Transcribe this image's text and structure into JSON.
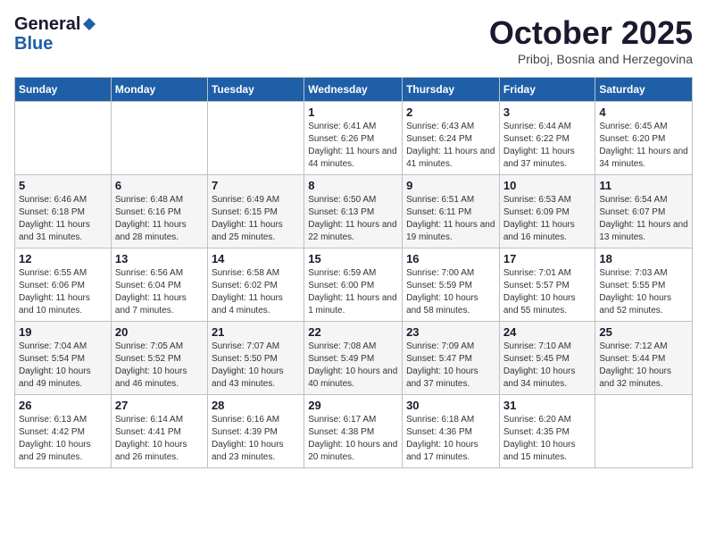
{
  "logo": {
    "general": "General",
    "blue": "Blue"
  },
  "title": "October 2025",
  "location": "Priboj, Bosnia and Herzegovina",
  "weekdays": [
    "Sunday",
    "Monday",
    "Tuesday",
    "Wednesday",
    "Thursday",
    "Friday",
    "Saturday"
  ],
  "weeks": [
    [
      {
        "day": "",
        "info": ""
      },
      {
        "day": "",
        "info": ""
      },
      {
        "day": "",
        "info": ""
      },
      {
        "day": "1",
        "info": "Sunrise: 6:41 AM\nSunset: 6:26 PM\nDaylight: 11 hours\nand 44 minutes."
      },
      {
        "day": "2",
        "info": "Sunrise: 6:43 AM\nSunset: 6:24 PM\nDaylight: 11 hours\nand 41 minutes."
      },
      {
        "day": "3",
        "info": "Sunrise: 6:44 AM\nSunset: 6:22 PM\nDaylight: 11 hours\nand 37 minutes."
      },
      {
        "day": "4",
        "info": "Sunrise: 6:45 AM\nSunset: 6:20 PM\nDaylight: 11 hours\nand 34 minutes."
      }
    ],
    [
      {
        "day": "5",
        "info": "Sunrise: 6:46 AM\nSunset: 6:18 PM\nDaylight: 11 hours\nand 31 minutes."
      },
      {
        "day": "6",
        "info": "Sunrise: 6:48 AM\nSunset: 6:16 PM\nDaylight: 11 hours\nand 28 minutes."
      },
      {
        "day": "7",
        "info": "Sunrise: 6:49 AM\nSunset: 6:15 PM\nDaylight: 11 hours\nand 25 minutes."
      },
      {
        "day": "8",
        "info": "Sunrise: 6:50 AM\nSunset: 6:13 PM\nDaylight: 11 hours\nand 22 minutes."
      },
      {
        "day": "9",
        "info": "Sunrise: 6:51 AM\nSunset: 6:11 PM\nDaylight: 11 hours\nand 19 minutes."
      },
      {
        "day": "10",
        "info": "Sunrise: 6:53 AM\nSunset: 6:09 PM\nDaylight: 11 hours\nand 16 minutes."
      },
      {
        "day": "11",
        "info": "Sunrise: 6:54 AM\nSunset: 6:07 PM\nDaylight: 11 hours\nand 13 minutes."
      }
    ],
    [
      {
        "day": "12",
        "info": "Sunrise: 6:55 AM\nSunset: 6:06 PM\nDaylight: 11 hours\nand 10 minutes."
      },
      {
        "day": "13",
        "info": "Sunrise: 6:56 AM\nSunset: 6:04 PM\nDaylight: 11 hours\nand 7 minutes."
      },
      {
        "day": "14",
        "info": "Sunrise: 6:58 AM\nSunset: 6:02 PM\nDaylight: 11 hours\nand 4 minutes."
      },
      {
        "day": "15",
        "info": "Sunrise: 6:59 AM\nSunset: 6:00 PM\nDaylight: 11 hours\nand 1 minute."
      },
      {
        "day": "16",
        "info": "Sunrise: 7:00 AM\nSunset: 5:59 PM\nDaylight: 10 hours\nand 58 minutes."
      },
      {
        "day": "17",
        "info": "Sunrise: 7:01 AM\nSunset: 5:57 PM\nDaylight: 10 hours\nand 55 minutes."
      },
      {
        "day": "18",
        "info": "Sunrise: 7:03 AM\nSunset: 5:55 PM\nDaylight: 10 hours\nand 52 minutes."
      }
    ],
    [
      {
        "day": "19",
        "info": "Sunrise: 7:04 AM\nSunset: 5:54 PM\nDaylight: 10 hours\nand 49 minutes."
      },
      {
        "day": "20",
        "info": "Sunrise: 7:05 AM\nSunset: 5:52 PM\nDaylight: 10 hours\nand 46 minutes."
      },
      {
        "day": "21",
        "info": "Sunrise: 7:07 AM\nSunset: 5:50 PM\nDaylight: 10 hours\nand 43 minutes."
      },
      {
        "day": "22",
        "info": "Sunrise: 7:08 AM\nSunset: 5:49 PM\nDaylight: 10 hours\nand 40 minutes."
      },
      {
        "day": "23",
        "info": "Sunrise: 7:09 AM\nSunset: 5:47 PM\nDaylight: 10 hours\nand 37 minutes."
      },
      {
        "day": "24",
        "info": "Sunrise: 7:10 AM\nSunset: 5:45 PM\nDaylight: 10 hours\nand 34 minutes."
      },
      {
        "day": "25",
        "info": "Sunrise: 7:12 AM\nSunset: 5:44 PM\nDaylight: 10 hours\nand 32 minutes."
      }
    ],
    [
      {
        "day": "26",
        "info": "Sunrise: 6:13 AM\nSunset: 4:42 PM\nDaylight: 10 hours\nand 29 minutes."
      },
      {
        "day": "27",
        "info": "Sunrise: 6:14 AM\nSunset: 4:41 PM\nDaylight: 10 hours\nand 26 minutes."
      },
      {
        "day": "28",
        "info": "Sunrise: 6:16 AM\nSunset: 4:39 PM\nDaylight: 10 hours\nand 23 minutes."
      },
      {
        "day": "29",
        "info": "Sunrise: 6:17 AM\nSunset: 4:38 PM\nDaylight: 10 hours\nand 20 minutes."
      },
      {
        "day": "30",
        "info": "Sunrise: 6:18 AM\nSunset: 4:36 PM\nDaylight: 10 hours\nand 17 minutes."
      },
      {
        "day": "31",
        "info": "Sunrise: 6:20 AM\nSunset: 4:35 PM\nDaylight: 10 hours\nand 15 minutes."
      },
      {
        "day": "",
        "info": ""
      }
    ]
  ]
}
